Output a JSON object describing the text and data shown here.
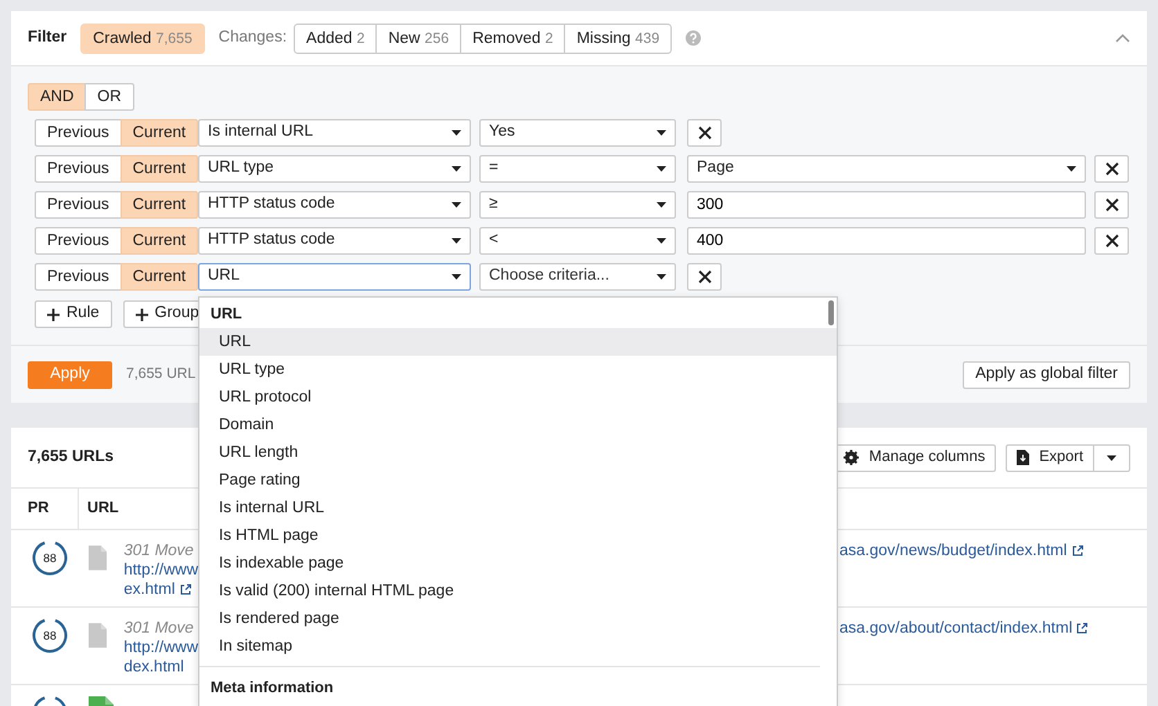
{
  "filter": {
    "title": "Filter",
    "crawled": {
      "label": "Crawled",
      "count": "7,655",
      "selected": true
    },
    "changes_label": "Changes:",
    "changes": [
      {
        "label": "Added",
        "count": "2",
        "selected": false
      },
      {
        "label": "New",
        "count": "256",
        "selected": false
      },
      {
        "label": "Removed",
        "count": "2",
        "selected": false
      },
      {
        "label": "Missing",
        "count": "439",
        "selected": false
      }
    ]
  },
  "logic": [
    {
      "label": "AND",
      "selected": true
    },
    {
      "label": "OR",
      "selected": false
    }
  ],
  "rules": [
    {
      "versions": [
        {
          "label": "Previous",
          "selected": false
        },
        {
          "label": "Current",
          "selected": true
        }
      ],
      "field": "Is internal URL",
      "field_focused": false,
      "operator": "Yes"
    },
    {
      "versions": [
        {
          "label": "Previous",
          "selected": false
        },
        {
          "label": "Current",
          "selected": true
        }
      ],
      "field": "URL type",
      "field_focused": false,
      "operator": "=",
      "value": {
        "kind": "select",
        "text": "Page"
      }
    },
    {
      "versions": [
        {
          "label": "Previous",
          "selected": false
        },
        {
          "label": "Current",
          "selected": true
        }
      ],
      "field": "HTTP status code",
      "field_focused": false,
      "operator": "≥",
      "value": {
        "kind": "input",
        "text": "300"
      }
    },
    {
      "versions": [
        {
          "label": "Previous",
          "selected": false
        },
        {
          "label": "Current",
          "selected": true
        }
      ],
      "field": "HTTP status code",
      "field_focused": false,
      "operator": "<",
      "value": {
        "kind": "input",
        "text": "400"
      }
    },
    {
      "versions": [
        {
          "label": "Previous",
          "selected": false
        },
        {
          "label": "Current",
          "selected": true
        }
      ],
      "field": "URL",
      "field_focused": true,
      "operator_placeholder": "Choose criteria..."
    }
  ],
  "add_buttons": [
    "Rule",
    "Group"
  ],
  "apply": {
    "button": "Apply",
    "summary": "7,655 URL",
    "global_button": "Apply as global filter"
  },
  "table": {
    "title": "7,655 URLs",
    "manage_button": "Manage columns",
    "export_button": "Export",
    "columns": [
      "PR",
      "URL"
    ],
    "rows": [
      {
        "pr": "88",
        "color": "#c8c8c8",
        "status": "301 Move",
        "url_lines": [
          "http://www",
          "ex.html"
        ],
        "url_right": "asa.gov/news/budget/index.html"
      },
      {
        "pr": "88",
        "color": "#c8c8c8",
        "status": "301 Move",
        "url_lines": [
          "http://www",
          "dex.html"
        ],
        "url_right": "asa.gov/about/contact/index.html"
      },
      {
        "color": "#4caf50"
      }
    ]
  },
  "dropdown": {
    "groups": [
      {
        "title": "URL",
        "items": [
          {
            "label": "URL",
            "selected": true
          },
          {
            "label": "URL type",
            "selected": false
          },
          {
            "label": "URL protocol",
            "selected": false
          },
          {
            "label": "Domain",
            "selected": false
          },
          {
            "label": "URL length",
            "selected": false
          },
          {
            "label": "Page rating",
            "selected": false
          },
          {
            "label": "Is internal URL",
            "selected": false
          },
          {
            "label": "Is HTML page",
            "selected": false
          },
          {
            "label": "Is indexable page",
            "selected": false
          },
          {
            "label": "Is valid (200) internal HTML page",
            "selected": false
          },
          {
            "label": "Is rendered page",
            "selected": false
          },
          {
            "label": "In sitemap",
            "selected": false
          }
        ]
      },
      {
        "title": "Meta information"
      }
    ]
  }
}
